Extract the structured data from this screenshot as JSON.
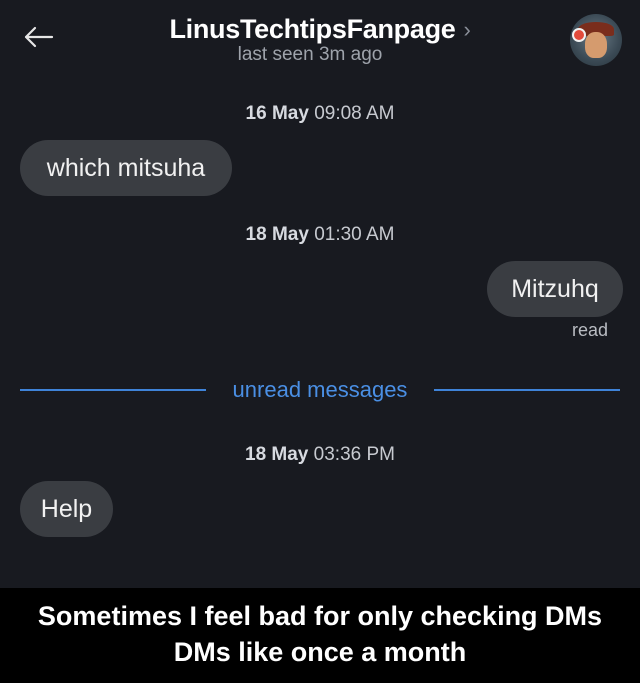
{
  "header": {
    "back_icon": "arrow-left-icon",
    "contact_name": "LinusTechtipsFanpage",
    "chevron": "›",
    "last_seen": "last seen 3m ago",
    "avatar_icon": "avatar-image"
  },
  "messages": {
    "stamp1": {
      "date": "16 May",
      "time": "09:08 AM"
    },
    "in1": "which mitsuha",
    "stamp2": {
      "date": "18 May",
      "time": "01:30 AM"
    },
    "out1": "Mitzuhq",
    "out1_status": "read",
    "unread_label": "unread messages",
    "stamp3": {
      "date": "18 May",
      "time": "03:36 PM"
    },
    "in2": "Help"
  },
  "caption": {
    "line1": "Sometimes I feel bad for only checking DMs",
    "line2": "DMs like once a month"
  },
  "colors": {
    "background": "#181a20",
    "bubble": "#3a3d42",
    "accent_blue": "#3f83d8"
  }
}
